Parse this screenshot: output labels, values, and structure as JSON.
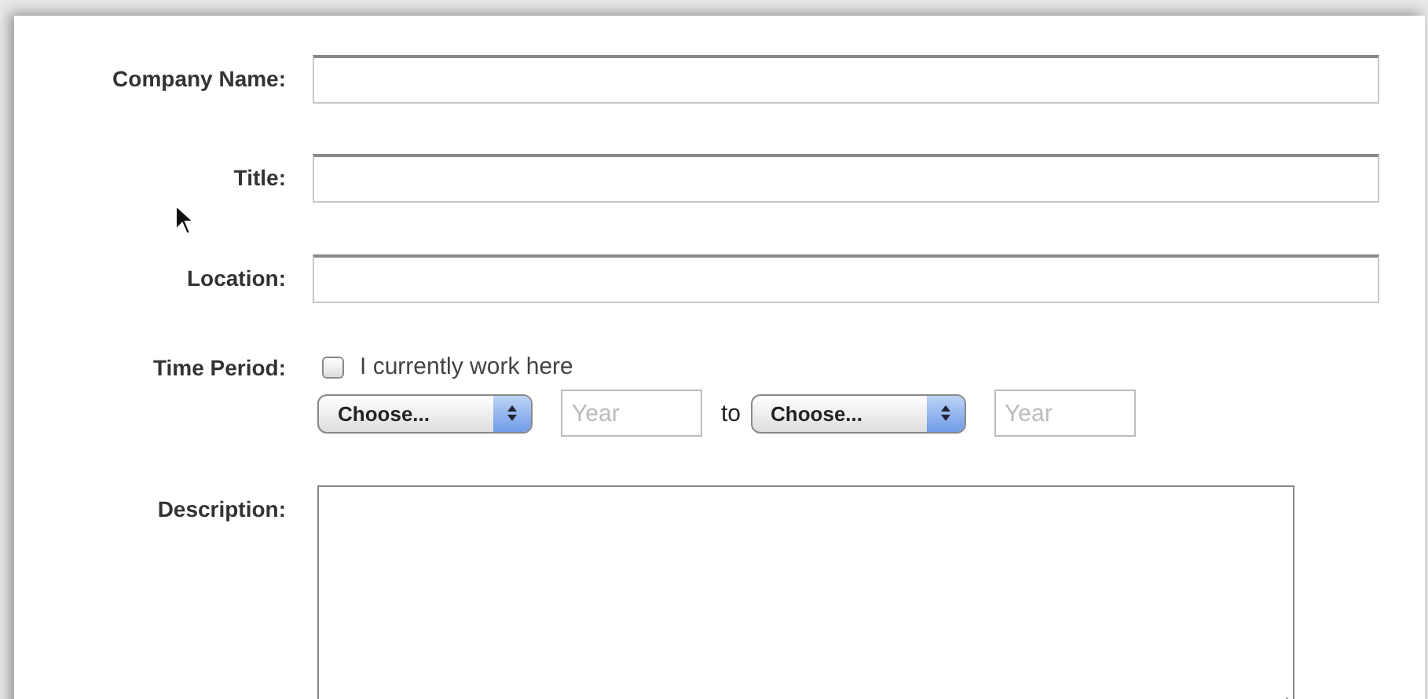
{
  "fields": [
    {
      "kind": "text",
      "label": "Company Name:"
    },
    {
      "kind": "text",
      "label": "Title:"
    },
    {
      "kind": "text",
      "label": "Location:"
    },
    {
      "kind": "period",
      "label": "Time Period:",
      "checkbox": {
        "label": "I currently work here",
        "checked": false
      },
      "start": {
        "select": "Choose...",
        "year_placeholder": "Year"
      },
      "separator": "to",
      "end": {
        "select": "Choose...",
        "year_placeholder": "Year"
      }
    },
    {
      "kind": "textarea",
      "label": "Description:"
    }
  ]
}
